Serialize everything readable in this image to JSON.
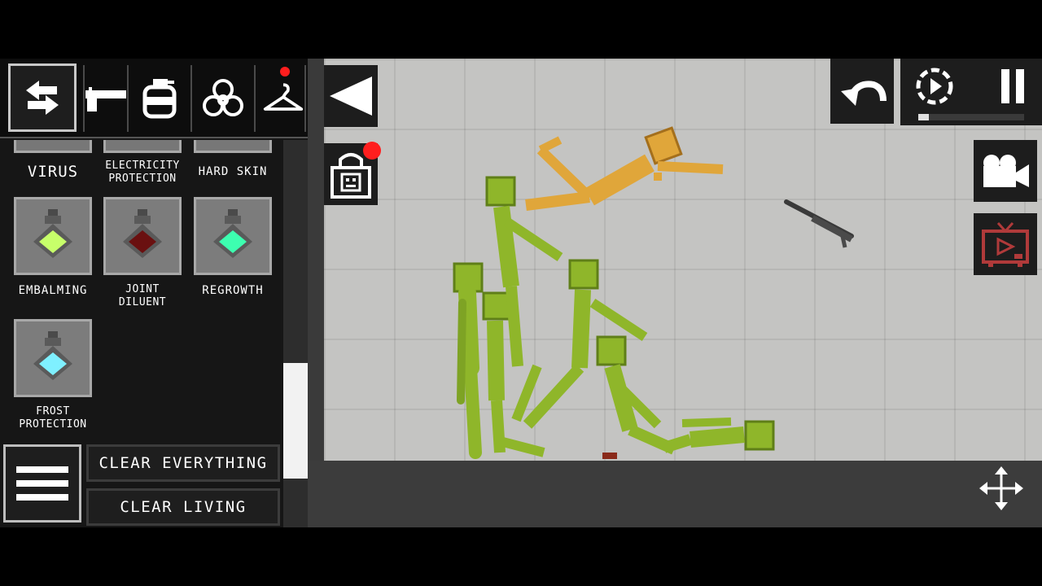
{
  "toolbar": {
    "tabs": [
      {
        "icon": "pistol-icon"
      },
      {
        "icon": "grenade-icon"
      },
      {
        "icon": "biohazard-icon"
      },
      {
        "icon": "hanger-icon",
        "notification": true
      }
    ]
  },
  "items": {
    "partial_row": [
      {
        "label": "VIRUS"
      },
      {
        "label": "ELECTRICITY PROTECTION"
      },
      {
        "label": "HARD SKIN"
      }
    ],
    "row_1": [
      {
        "label": "EMBALMING",
        "liquid_color": "#c7ff6a"
      },
      {
        "label": "JOINT DILUENT",
        "liquid_color": "#6a1010"
      },
      {
        "label": "REGROWTH",
        "liquid_color": "#3dffb0"
      }
    ],
    "row_2": [
      {
        "label": "FROST PROTECTION",
        "liquid_color": "#7ff0ff"
      }
    ]
  },
  "actions": {
    "clear_everything": "CLEAR EVERYTHING",
    "clear_living": "CLEAR LIVING"
  },
  "colors": {
    "melon": "#8fb62a",
    "melon_dark": "#5f7f18",
    "orange_ragdoll": "#e0a63a",
    "notification": "#ff1e1e",
    "tv_accent": "#b03a3a"
  },
  "time_scale": {
    "level": 0.1
  }
}
